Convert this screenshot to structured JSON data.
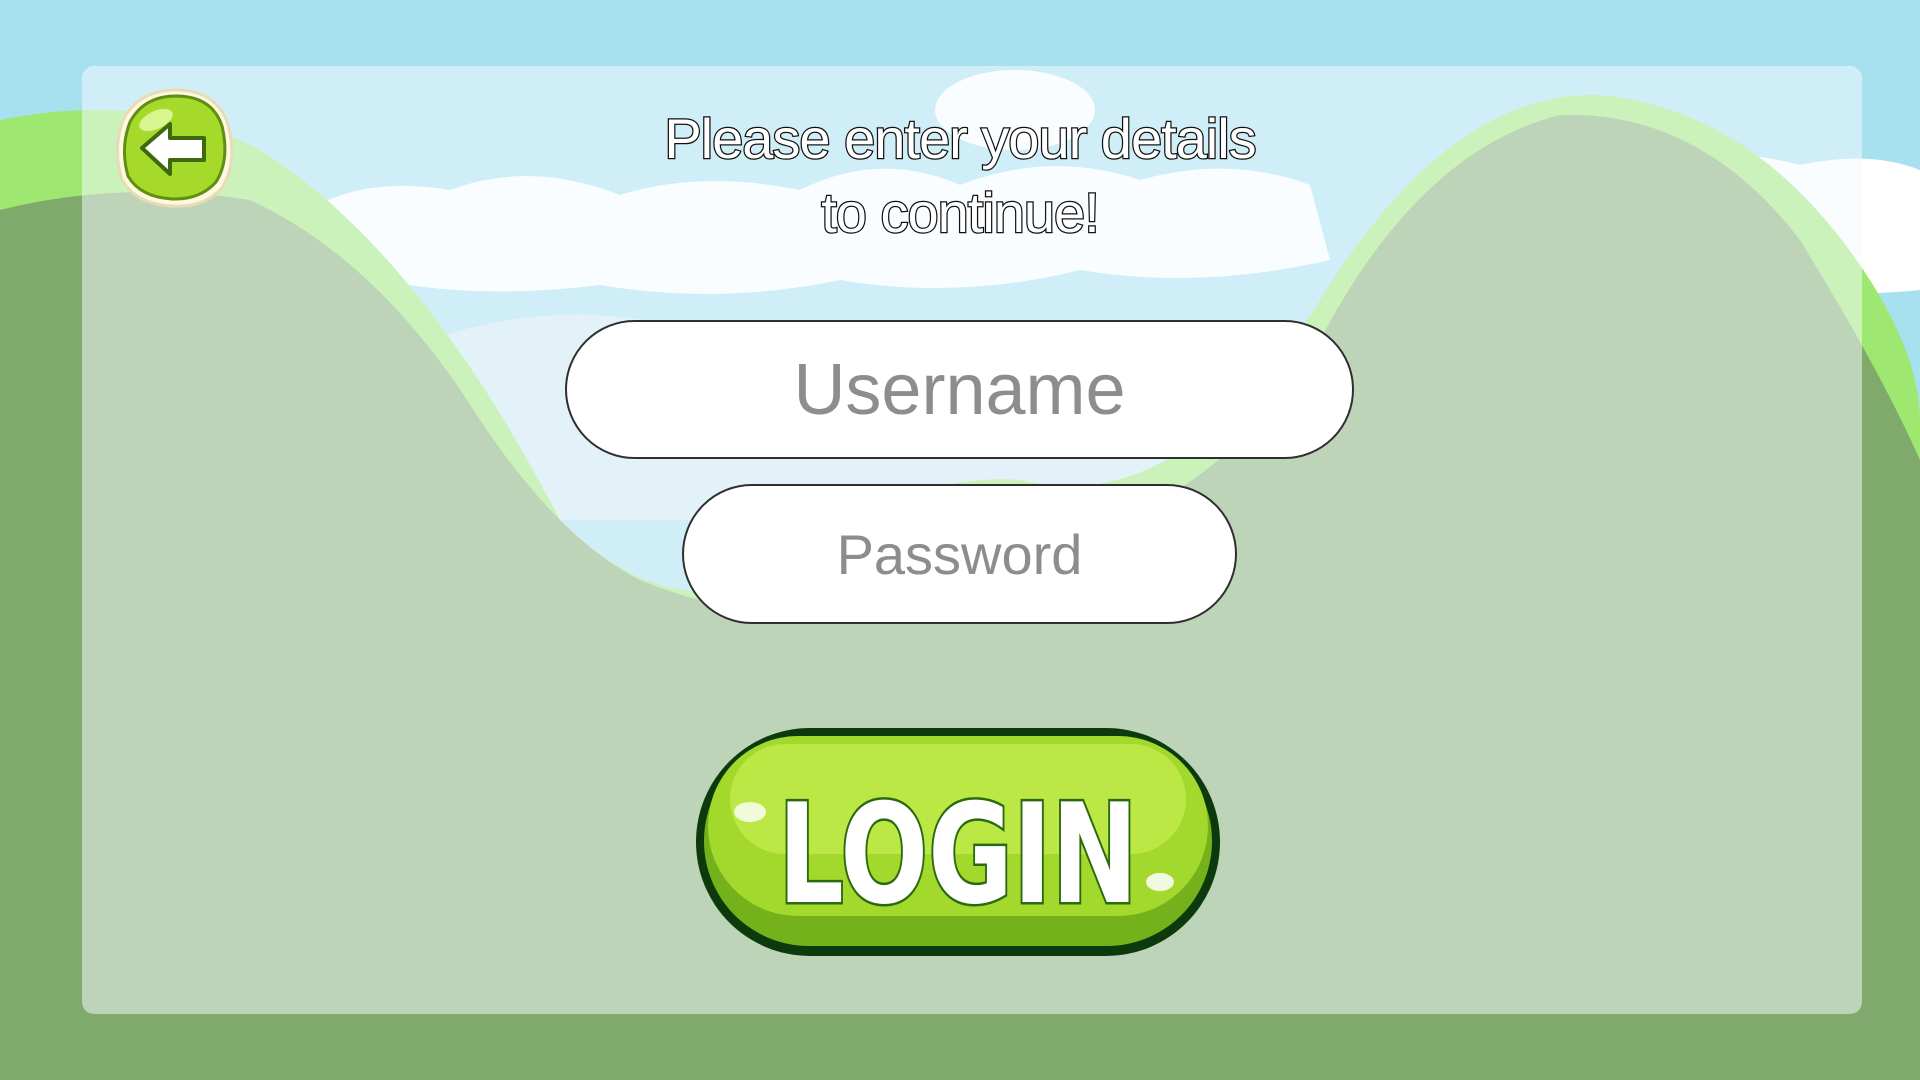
{
  "prompt": {
    "line1": "Please enter your details",
    "line2": "to continue!"
  },
  "form": {
    "username_placeholder": "Username",
    "password_placeholder": "Password",
    "login_label": "LOGIN"
  },
  "back_button": {
    "icon": "arrow-left-icon"
  },
  "colors": {
    "sky": "#a7e0ef",
    "grass_dark": "#7faa6c",
    "grass_light": "#9ee872",
    "button_green": "#9fd82a",
    "button_outline": "#0d3a0d"
  }
}
